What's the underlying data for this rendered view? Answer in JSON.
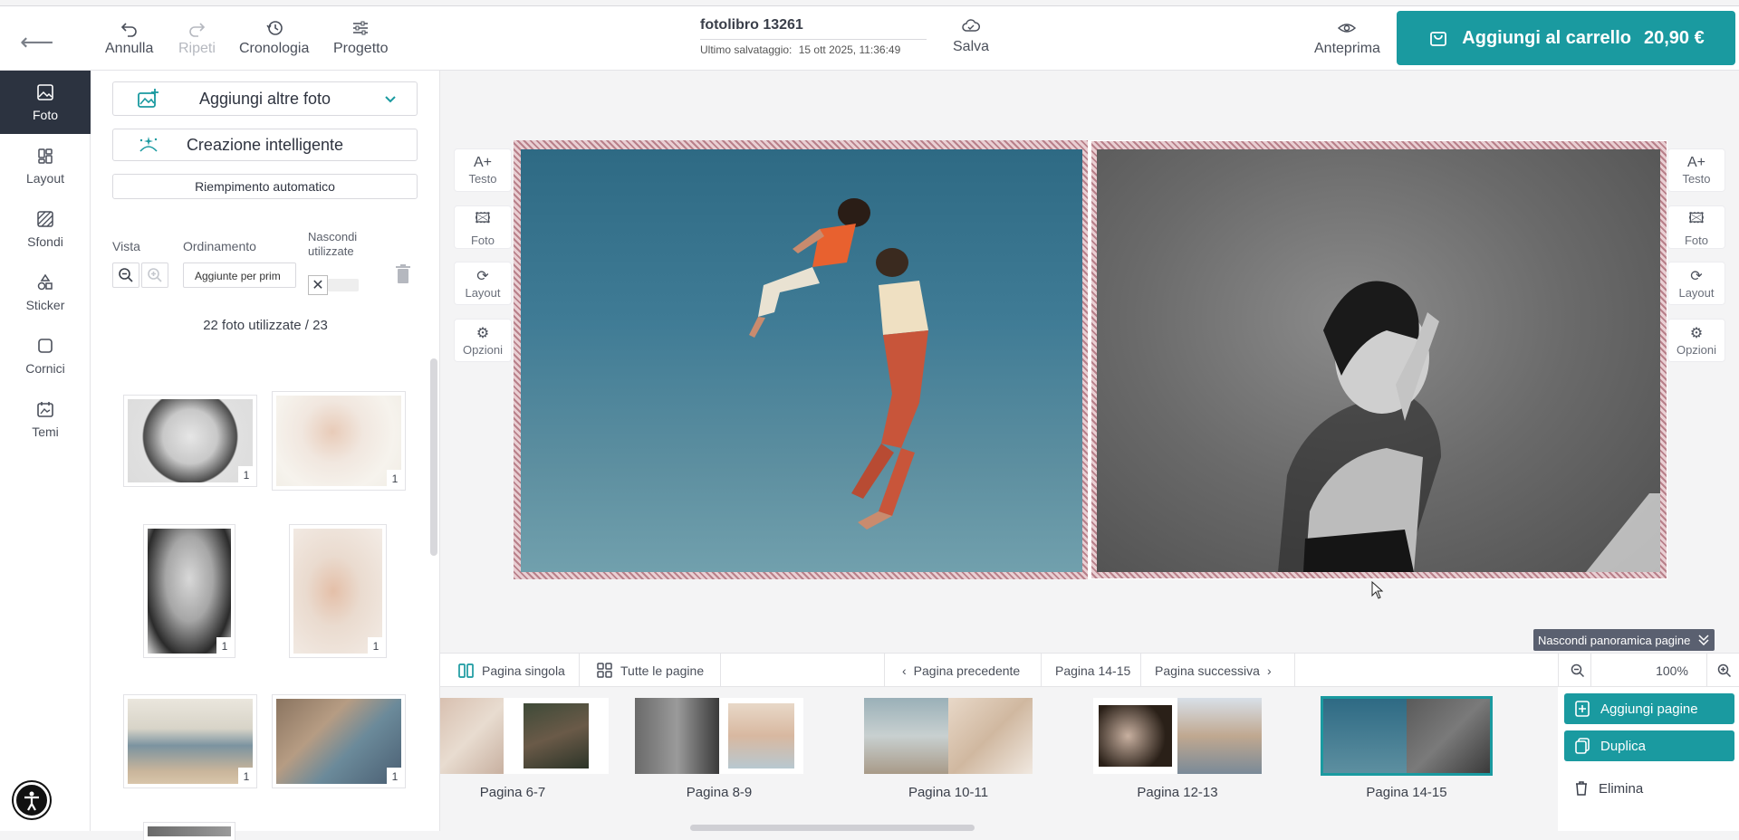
{
  "topbar": {
    "back_icon": "arrow-left-icon",
    "undo_label": "Annulla",
    "redo_label": "Ripeti",
    "history_label": "Cronologia",
    "project_label": "Progetto",
    "doc_title": "fotolibro 13261",
    "saved_label": "Ultimo salvataggio:",
    "saved_value": "15 ott 2025, 11:36:49",
    "save_label": "Salva",
    "preview_label": "Anteprima",
    "cart_label": "Aggiungi al carrello",
    "cart_price": "20,90 €",
    "accent": "#1a9aa0"
  },
  "rail": {
    "items": [
      {
        "label": "Foto",
        "icon": "photo-icon",
        "active": true
      },
      {
        "label": "Layout",
        "icon": "layout-icon"
      },
      {
        "label": "Sfondi",
        "icon": "background-icon"
      },
      {
        "label": "Sticker",
        "icon": "sticker-icon"
      },
      {
        "label": "Cornici",
        "icon": "frame-icon"
      },
      {
        "label": "Temi",
        "icon": "theme-icon"
      }
    ]
  },
  "panel": {
    "add_photos": "Aggiungi altre foto",
    "smart_create": "Creazione intelligente",
    "autofill": "Riempimento automatico",
    "view_label": "Vista",
    "sort_label": "Ordinamento",
    "sort_value": "Aggiunte per prim",
    "hide_label": "Nascondi utilizzate",
    "photo_count": "22 foto utilizzate / 23",
    "thumb_badge": "1"
  },
  "tools": {
    "text": "Testo",
    "photo": "Foto",
    "layout": "Layout",
    "options": "Opzioni"
  },
  "bottom": {
    "hide_overview": "Nascondi panoramica pagine",
    "single_page": "Pagina singola",
    "all_pages": "Tutte le pagine",
    "prev_page": "Pagina precedente",
    "current_page": "Pagina 14-15",
    "next_page": "Pagina successiva",
    "zoom_value": "100%",
    "spreads": [
      "Pagina 6-7",
      "Pagina 8-9",
      "Pagina 10-11",
      "Pagina 12-13",
      "Pagina 14-15"
    ],
    "add_pages": "Aggiungi pagine",
    "duplicate": "Duplica",
    "delete": "Elimina"
  }
}
